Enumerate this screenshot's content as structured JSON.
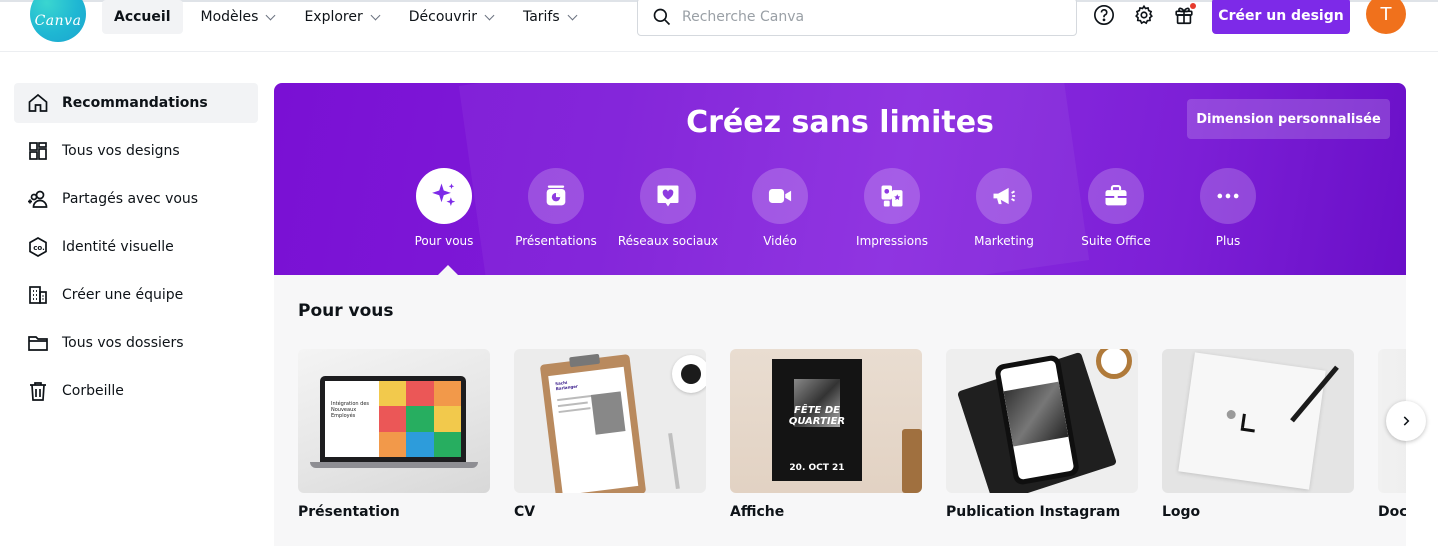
{
  "brand": {
    "logo_text": "Canva",
    "accent": "#7d2ae8"
  },
  "nav": {
    "items": [
      {
        "label": "Accueil",
        "active": true
      },
      {
        "label": "Modèles"
      },
      {
        "label": "Explorer"
      },
      {
        "label": "Découvrir"
      },
      {
        "label": "Tarifs"
      }
    ]
  },
  "search": {
    "placeholder": "Recherche Canva"
  },
  "header": {
    "icons": [
      "help-icon",
      "gear-icon",
      "gift-icon"
    ],
    "create_label": "Créer un design",
    "avatar_initial": "T"
  },
  "sidebar": {
    "items": [
      {
        "label": "Recommandations",
        "icon": "home-icon",
        "active": true
      },
      {
        "label": "Tous vos designs",
        "icon": "grid-icon"
      },
      {
        "label": "Partagés avec vous",
        "icon": "shared-users-icon"
      },
      {
        "label": "Identité visuelle",
        "icon": "brand-kit-icon"
      },
      {
        "label": "Créer une équipe",
        "icon": "building-icon"
      },
      {
        "label": "Tous vos dossiers",
        "icon": "folder-icon"
      },
      {
        "label": "Corbeille",
        "icon": "trash-icon"
      }
    ]
  },
  "hero": {
    "title": "Créez sans limites",
    "custom_size_label": "Dimension personnalisée",
    "categories": [
      {
        "label": "Pour vous",
        "icon": "sparkle-icon",
        "active": true
      },
      {
        "label": "Présentations",
        "icon": "presentation-icon"
      },
      {
        "label": "Réseaux sociaux",
        "icon": "heart-chat-icon"
      },
      {
        "label": "Vidéo",
        "icon": "video-camera-icon"
      },
      {
        "label": "Impressions",
        "icon": "print-icon"
      },
      {
        "label": "Marketing",
        "icon": "megaphone-icon"
      },
      {
        "label": "Suite Office",
        "icon": "briefcase-icon"
      },
      {
        "label": "Plus",
        "icon": "more-dots-icon"
      }
    ]
  },
  "section": {
    "title": "Pour vous",
    "cards": [
      {
        "label": "Présentation",
        "thumb_text": [
          "Intégration des",
          "Nouveaux",
          "Employés"
        ]
      },
      {
        "label": "CV",
        "thumb_text": [
          "Sachi",
          "Barlanger"
        ]
      },
      {
        "label": "Affiche",
        "thumb_text": [
          "FÊTE DE",
          "QUARTIER",
          "20. OCT 21"
        ]
      },
      {
        "label": "Publication Instagram"
      },
      {
        "label": "Logo"
      },
      {
        "label": "Docu"
      }
    ]
  }
}
